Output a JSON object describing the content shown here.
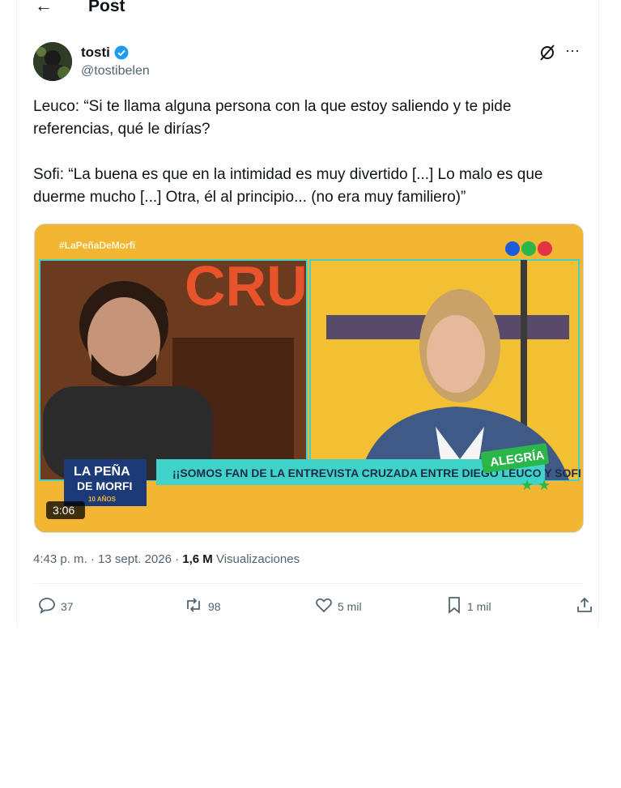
{
  "header": {
    "back_icon": "arrow-left-icon",
    "title": "Post"
  },
  "author": {
    "name": "tosti",
    "handle": "@tostibelen",
    "verified_color": "#1d9bf0"
  },
  "post": {
    "paragraph1": "Leuco: “Si te llama alguna persona con la que estoy saliendo y te pide referencias, qué le dirías?",
    "paragraph2": "Sofi: “La buena es que en la intimidad es muy divertido [...] Lo malo es que duerme mucho [...] Otra, él al principio... (no era muy familiero)”"
  },
  "video": {
    "hashtag": "#LaPeñaDeMorfi",
    "show_logo_line1": "LA PEÑA",
    "show_logo_line2": "DE MORFI",
    "show_logo_line3": "10 AÑOS",
    "banner": "¡¡SOMOS FAN DE LA ENTREVISTA CRUZADA ENTRE DIEGO LEUCO Y SOFI MARTÍNEZ!!",
    "tag": "ALEGRÍA",
    "duration": "3:06",
    "accent_yellow": "#f2b632",
    "accent_teal": "#3fd3c9",
    "accent_green": "#2bb64a"
  },
  "meta": {
    "time": "4:43 p. m. · 13 sept. 2026 · ",
    "views_count": "1,6 M",
    "views_label": " Visualizaciones"
  },
  "actions": {
    "replies": "37",
    "reposts": "98",
    "likes": "5 mil",
    "bookmarks": "1 mil"
  }
}
